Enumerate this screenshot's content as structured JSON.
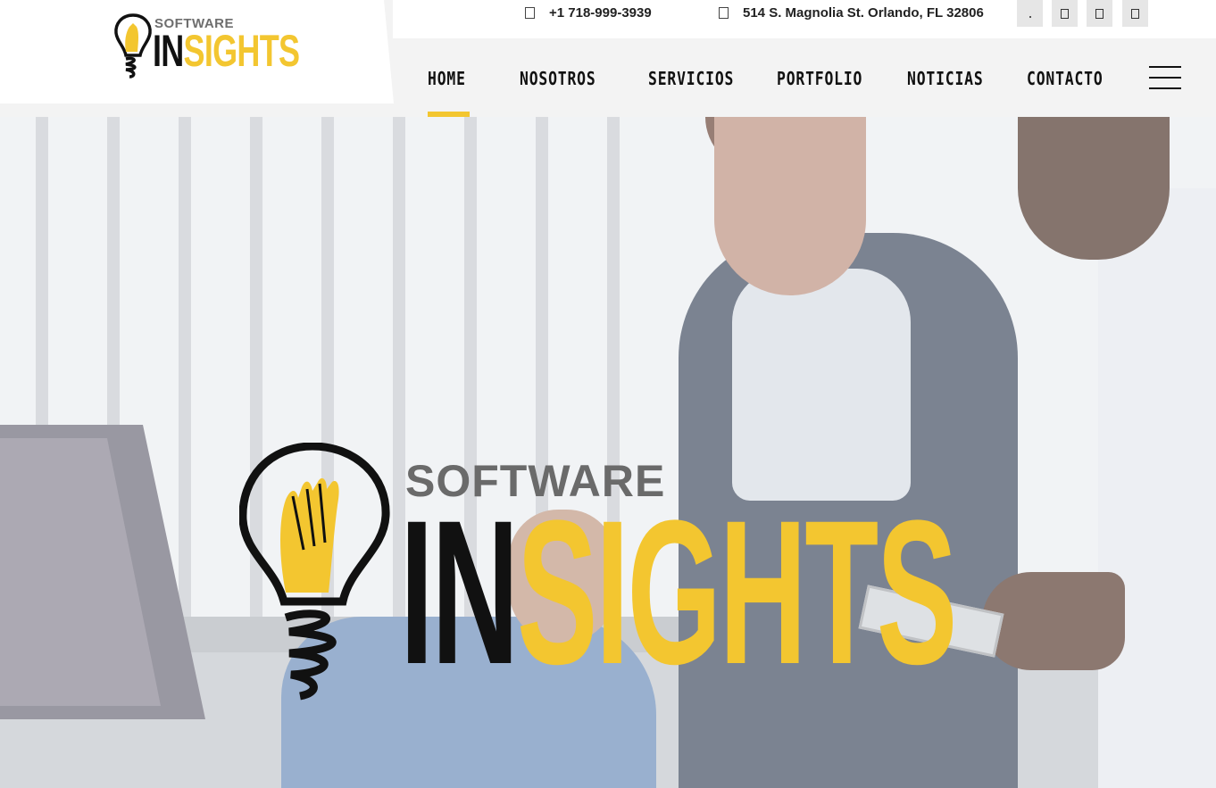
{
  "brand": {
    "software": "SOFTWARE",
    "in": "IN",
    "sights": "SIGHTS"
  },
  "topbar": {
    "phone": "+1 718-999-3939",
    "address": "514 S. Magnolia St. Orlando, FL 32806",
    "social": [
      "social-link-1",
      "social-link-2",
      "social-link-3",
      "social-link-4"
    ]
  },
  "nav": {
    "items": [
      "HOME",
      "NOSOTROS",
      "SERVICIOS",
      "PORTFOLIO",
      "NOTICIAS",
      "CONTACTO"
    ],
    "active": "HOME"
  },
  "colors": {
    "accent": "#f3c630",
    "text": "#111111",
    "grey": "#6e6e6e"
  },
  "icons": {
    "phone": "phone-icon",
    "address": "map-marker-icon",
    "menu": "hamburger-menu-icon"
  }
}
